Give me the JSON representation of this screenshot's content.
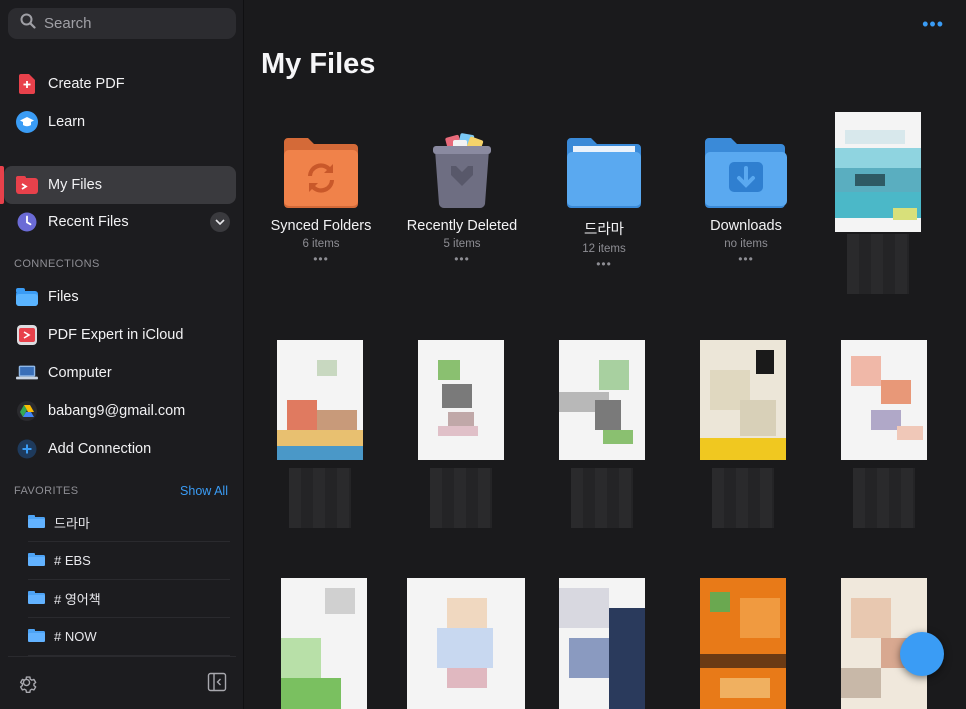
{
  "sidebar": {
    "search_placeholder": "Search",
    "top_items": [
      {
        "label": "Create PDF"
      },
      {
        "label": "Learn"
      }
    ],
    "my_files": "My Files",
    "recent_files": "Recent Files",
    "connections_header": "CONNECTIONS",
    "connections": [
      {
        "label": "Files"
      },
      {
        "label": "PDF Expert in iCloud"
      },
      {
        "label": "Computer"
      },
      {
        "label": "babang9@gmail.com"
      },
      {
        "label": "Add Connection"
      }
    ],
    "favorites_header": "FAVORITES",
    "show_all": "Show All",
    "favorites": [
      {
        "label": "드라마"
      },
      {
        "label": "# EBS"
      },
      {
        "label": "# 영어책"
      },
      {
        "label": "# NOW"
      }
    ]
  },
  "main": {
    "title": "My Files",
    "more": "•••",
    "folders": [
      {
        "name": "Synced Folders",
        "count": "6 items",
        "more": "•••"
      },
      {
        "name": "Recently Deleted",
        "count": "5 items",
        "more": "•••"
      },
      {
        "name": "드라마",
        "count": "12 items",
        "more": "•••"
      },
      {
        "name": "Downloads",
        "count": "no items",
        "more": "•••"
      }
    ]
  },
  "colors": {
    "accent": "#3a9cf5",
    "active_bar": "#e8414b",
    "folder_blue": "#5aa9f0",
    "folder_orange": "#f0824a"
  }
}
